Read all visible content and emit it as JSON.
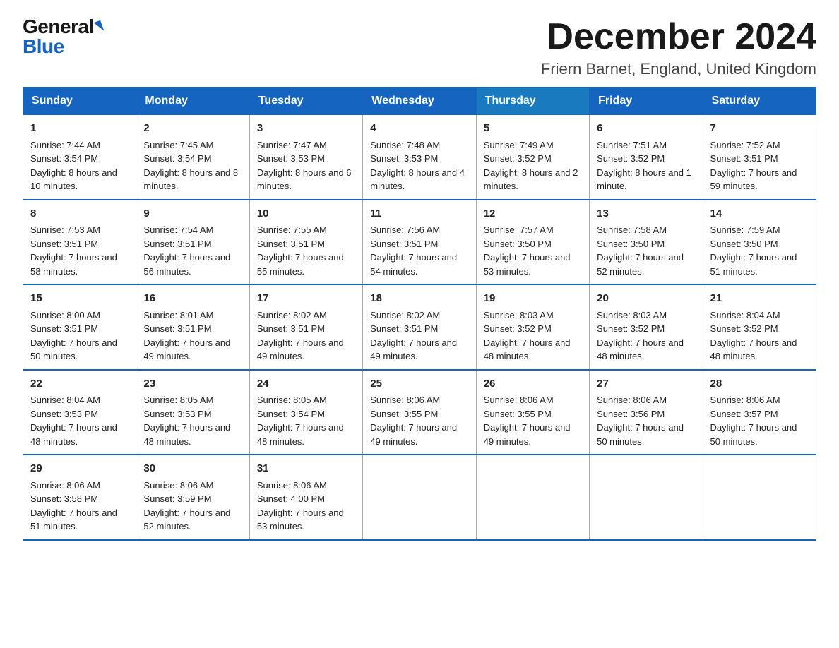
{
  "logo": {
    "general": "General",
    "blue": "Blue",
    "triangle": "▶"
  },
  "title": "December 2024",
  "subtitle": "Friern Barnet, England, United Kingdom",
  "days_of_week": [
    "Sunday",
    "Monday",
    "Tuesday",
    "Wednesday",
    "Thursday",
    "Friday",
    "Saturday"
  ],
  "weeks": [
    [
      {
        "day": "1",
        "sunrise": "7:44 AM",
        "sunset": "3:54 PM",
        "daylight": "8 hours and 10 minutes."
      },
      {
        "day": "2",
        "sunrise": "7:45 AM",
        "sunset": "3:54 PM",
        "daylight": "8 hours and 8 minutes."
      },
      {
        "day": "3",
        "sunrise": "7:47 AM",
        "sunset": "3:53 PM",
        "daylight": "8 hours and 6 minutes."
      },
      {
        "day": "4",
        "sunrise": "7:48 AM",
        "sunset": "3:53 PM",
        "daylight": "8 hours and 4 minutes."
      },
      {
        "day": "5",
        "sunrise": "7:49 AM",
        "sunset": "3:52 PM",
        "daylight": "8 hours and 2 minutes."
      },
      {
        "day": "6",
        "sunrise": "7:51 AM",
        "sunset": "3:52 PM",
        "daylight": "8 hours and 1 minute."
      },
      {
        "day": "7",
        "sunrise": "7:52 AM",
        "sunset": "3:51 PM",
        "daylight": "7 hours and 59 minutes."
      }
    ],
    [
      {
        "day": "8",
        "sunrise": "7:53 AM",
        "sunset": "3:51 PM",
        "daylight": "7 hours and 58 minutes."
      },
      {
        "day": "9",
        "sunrise": "7:54 AM",
        "sunset": "3:51 PM",
        "daylight": "7 hours and 56 minutes."
      },
      {
        "day": "10",
        "sunrise": "7:55 AM",
        "sunset": "3:51 PM",
        "daylight": "7 hours and 55 minutes."
      },
      {
        "day": "11",
        "sunrise": "7:56 AM",
        "sunset": "3:51 PM",
        "daylight": "7 hours and 54 minutes."
      },
      {
        "day": "12",
        "sunrise": "7:57 AM",
        "sunset": "3:50 PM",
        "daylight": "7 hours and 53 minutes."
      },
      {
        "day": "13",
        "sunrise": "7:58 AM",
        "sunset": "3:50 PM",
        "daylight": "7 hours and 52 minutes."
      },
      {
        "day": "14",
        "sunrise": "7:59 AM",
        "sunset": "3:50 PM",
        "daylight": "7 hours and 51 minutes."
      }
    ],
    [
      {
        "day": "15",
        "sunrise": "8:00 AM",
        "sunset": "3:51 PM",
        "daylight": "7 hours and 50 minutes."
      },
      {
        "day": "16",
        "sunrise": "8:01 AM",
        "sunset": "3:51 PM",
        "daylight": "7 hours and 49 minutes."
      },
      {
        "day": "17",
        "sunrise": "8:02 AM",
        "sunset": "3:51 PM",
        "daylight": "7 hours and 49 minutes."
      },
      {
        "day": "18",
        "sunrise": "8:02 AM",
        "sunset": "3:51 PM",
        "daylight": "7 hours and 49 minutes."
      },
      {
        "day": "19",
        "sunrise": "8:03 AM",
        "sunset": "3:52 PM",
        "daylight": "7 hours and 48 minutes."
      },
      {
        "day": "20",
        "sunrise": "8:03 AM",
        "sunset": "3:52 PM",
        "daylight": "7 hours and 48 minutes."
      },
      {
        "day": "21",
        "sunrise": "8:04 AM",
        "sunset": "3:52 PM",
        "daylight": "7 hours and 48 minutes."
      }
    ],
    [
      {
        "day": "22",
        "sunrise": "8:04 AM",
        "sunset": "3:53 PM",
        "daylight": "7 hours and 48 minutes."
      },
      {
        "day": "23",
        "sunrise": "8:05 AM",
        "sunset": "3:53 PM",
        "daylight": "7 hours and 48 minutes."
      },
      {
        "day": "24",
        "sunrise": "8:05 AM",
        "sunset": "3:54 PM",
        "daylight": "7 hours and 48 minutes."
      },
      {
        "day": "25",
        "sunrise": "8:06 AM",
        "sunset": "3:55 PM",
        "daylight": "7 hours and 49 minutes."
      },
      {
        "day": "26",
        "sunrise": "8:06 AM",
        "sunset": "3:55 PM",
        "daylight": "7 hours and 49 minutes."
      },
      {
        "day": "27",
        "sunrise": "8:06 AM",
        "sunset": "3:56 PM",
        "daylight": "7 hours and 50 minutes."
      },
      {
        "day": "28",
        "sunrise": "8:06 AM",
        "sunset": "3:57 PM",
        "daylight": "7 hours and 50 minutes."
      }
    ],
    [
      {
        "day": "29",
        "sunrise": "8:06 AM",
        "sunset": "3:58 PM",
        "daylight": "7 hours and 51 minutes."
      },
      {
        "day": "30",
        "sunrise": "8:06 AM",
        "sunset": "3:59 PM",
        "daylight": "7 hours and 52 minutes."
      },
      {
        "day": "31",
        "sunrise": "8:06 AM",
        "sunset": "4:00 PM",
        "daylight": "7 hours and 53 minutes."
      },
      null,
      null,
      null,
      null
    ]
  ],
  "labels": {
    "sunrise": "Sunrise:",
    "sunset": "Sunset:",
    "daylight": "Daylight:"
  }
}
